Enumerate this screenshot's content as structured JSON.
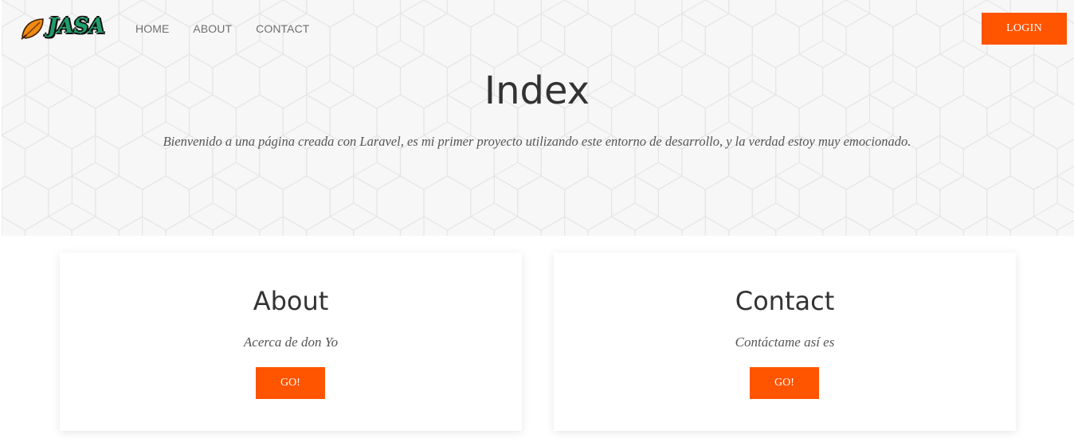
{
  "brand": {
    "logo_text": "JASA",
    "logo_icon": "leaf-icon",
    "accent_color": "#ff5400"
  },
  "nav": {
    "items": [
      "HOME",
      "ABOUT",
      "CONTACT"
    ],
    "login_label": "LOGIN"
  },
  "hero": {
    "title": "Index",
    "subtitle": "Bienvenido a una página creada con Laravel, es mi primer proyecto utilizando este entorno de desarrollo, y la verdad estoy muy emocionado."
  },
  "cards": [
    {
      "title": "About",
      "text": "Acerca de don Yo",
      "button": "GO!"
    },
    {
      "title": "Contact",
      "text": "Contáctame así es",
      "button": "GO!"
    }
  ]
}
